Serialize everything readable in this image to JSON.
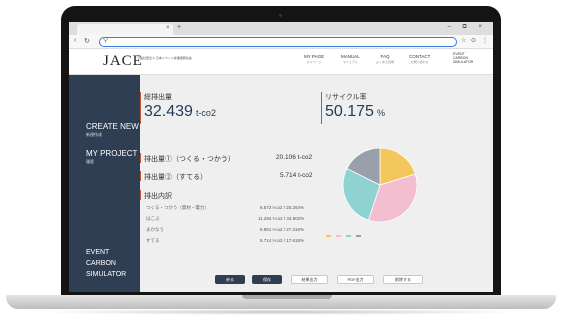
{
  "browser": {
    "tab_close": "×",
    "tab_plus": "+",
    "window_controls": "– ⧉ ×",
    "nav": {
      "back": "‹",
      "reload": "↻",
      "search": "⚲"
    },
    "right_icons": [
      "☆",
      "⊙",
      "⋮"
    ]
  },
  "site": {
    "logo": "JACE",
    "logo_sub": "一般社団法人 日本イベント産業振興協会",
    "nav": [
      {
        "en": "MY PAGE",
        "jp": "マイページ"
      },
      {
        "en": "MANUAL",
        "jp": "マニュアル"
      },
      {
        "en": "FAQ",
        "jp": "よくある質問"
      },
      {
        "en": "CONTACT",
        "jp": "お問い合わせ"
      }
    ],
    "event_link": [
      "EVENT",
      "CARBON",
      "SIMULATOR"
    ]
  },
  "sidebar": {
    "create_new": {
      "en": "CREATE NEW",
      "jp": "新規作成"
    },
    "my_project": {
      "en": "MY PROJECT",
      "jp": "履歴"
    },
    "footer": [
      "EVENT",
      "CARBON",
      "SIMULATOR"
    ]
  },
  "summary": {
    "total_label": "総排出量",
    "total_value": "32.439",
    "total_unit": "t-co2",
    "recycle_label": "リサイクル率",
    "recycle_value": "50.175",
    "recycle_unit": "%",
    "emission1_label": "排出量①（つくる・つかう）",
    "emission1_value": "20.106 t-co2",
    "emission2_label": "排出量②（すてる）",
    "emission2_value": "5.714 t-co2",
    "breakdown_label": "排出内訳",
    "breakdown": [
      {
        "name": "つくる・つかう（資材・電力）",
        "value": "6.573 t-co2 / 20.264%"
      },
      {
        "name": "はこぶ",
        "value": "11.284 t-co2 / 34.802%"
      },
      {
        "name": "まかなう",
        "value": "8.851 t-co2 / 27.316%"
      },
      {
        "name": "すてる",
        "value": "5.714 t-co2 / 17.618%"
      }
    ]
  },
  "chart_data": {
    "type": "pie",
    "series": [
      {
        "values": [
          20.264,
          34.802,
          27.316,
          17.618
        ]
      }
    ],
    "colors": [
      "#f2c75c",
      "#f3bfd0",
      "#8fd3d0",
      "#9aa0ab"
    ],
    "legend": "bottom"
  },
  "buttons": [
    "戻る",
    "保存",
    "結果出力",
    "PDF出力",
    "削除する"
  ]
}
